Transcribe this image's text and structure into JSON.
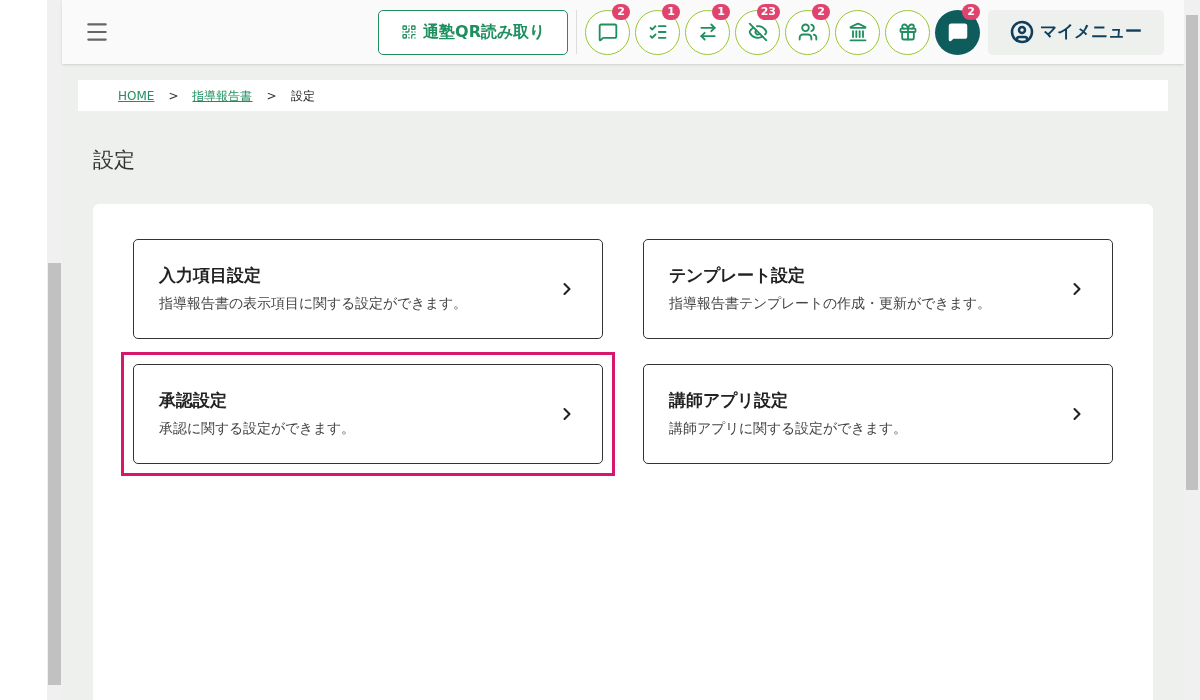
{
  "header": {
    "qr_button": "通塾QR読み取り",
    "icon_buttons": [
      {
        "kind": "comment",
        "badge": "2"
      },
      {
        "kind": "checklist",
        "badge": "1"
      },
      {
        "kind": "arrows",
        "badge": "1"
      },
      {
        "kind": "hidden",
        "badge": "23"
      },
      {
        "kind": "group",
        "badge": "2"
      },
      {
        "kind": "bank"
      },
      {
        "kind": "gift"
      },
      {
        "kind": "chat",
        "badge": "2"
      }
    ],
    "my_menu": "マイメニュー"
  },
  "breadcrumb": [
    {
      "label": "HOME",
      "link": true
    },
    {
      "label": "指導報告書",
      "link": true
    },
    {
      "label": "設定",
      "link": false
    }
  ],
  "breadcrumb_separator": ">",
  "page_title": "設定",
  "cards": [
    {
      "title": "入力項目設定",
      "description": "指導報告書の表示項目に関する設定ができます。",
      "highlighted": false
    },
    {
      "title": "テンプレート設定",
      "description": "指導報告書テンプレートの作成・更新ができます。",
      "highlighted": false
    },
    {
      "title": "承認設定",
      "description": "承認に関する設定ができます。",
      "highlighted": true
    },
    {
      "title": "講師アプリ設定",
      "description": "講師アプリに関する設定ができます。",
      "highlighted": false
    }
  ]
}
